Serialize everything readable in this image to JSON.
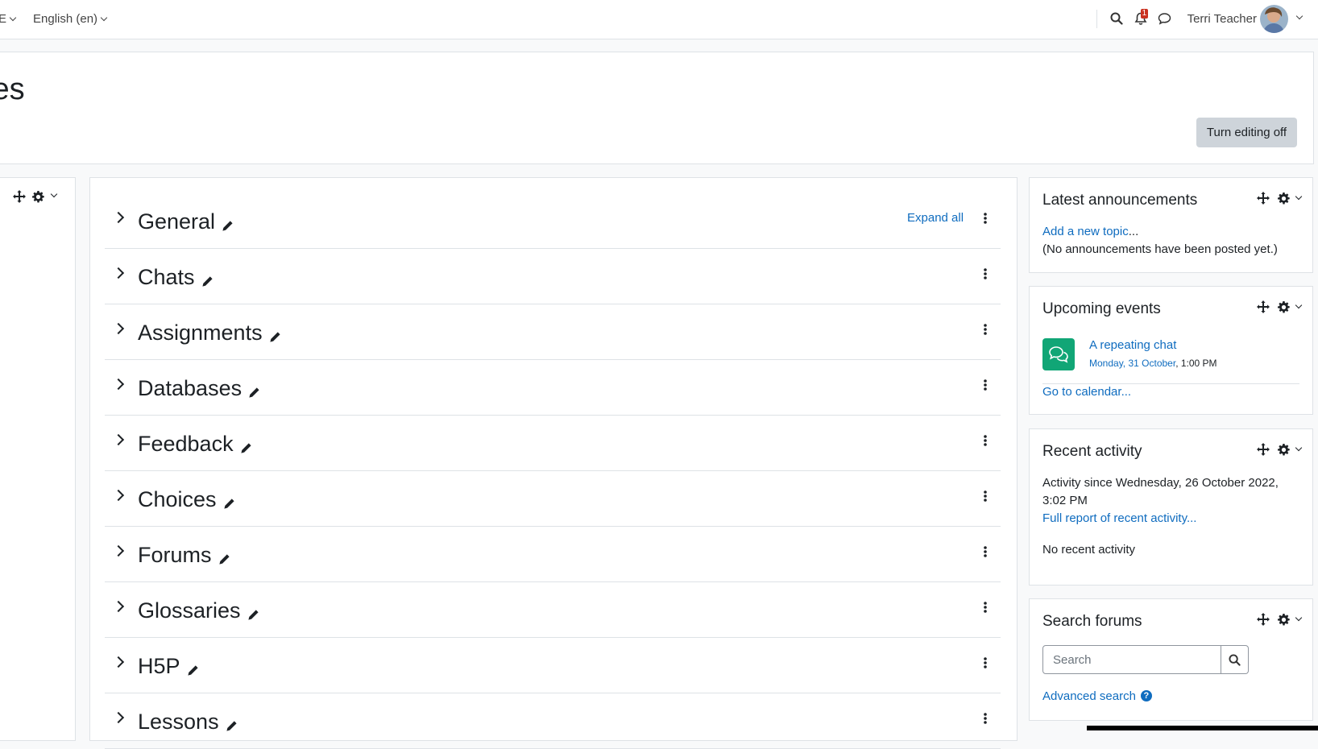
{
  "navbar": {
    "cut_menu_label": "E",
    "language": "English (en)",
    "notification_count": "1",
    "user_name": "Terri Teacher"
  },
  "header": {
    "title_fragment": "les",
    "edit_button": "Turn editing off"
  },
  "course": {
    "expand_all": "Expand all",
    "sections": [
      "General",
      "Chats",
      "Assignments",
      "Databases",
      "Feedback",
      "Choices",
      "Forums",
      "Glossaries",
      "H5P",
      "Lessons"
    ]
  },
  "blocks": {
    "announcements": {
      "title": "Latest announcements",
      "add_link": "Add a new topic",
      "add_suffix": "...",
      "empty": "(No announcements have been posted yet.)"
    },
    "events": {
      "title": "Upcoming events",
      "event_name": "A repeating chat",
      "event_date": "Monday, 31 October",
      "event_time": ", 1:00 PM",
      "calendar_link": "Go to calendar..."
    },
    "recent": {
      "title": "Recent activity",
      "since_line1": "Activity since Wednesday, 26 October 2022,",
      "since_line2": "3:02 PM",
      "full_report": "Full report of recent activity...",
      "none": "No recent activity"
    },
    "search": {
      "title": "Search forums",
      "placeholder": "Search",
      "advanced": "Advanced search",
      "help": "?"
    }
  },
  "colors": {
    "link": "#0f6cbf",
    "badge": "#ca3120",
    "event_icon_bg": "#11a676"
  }
}
